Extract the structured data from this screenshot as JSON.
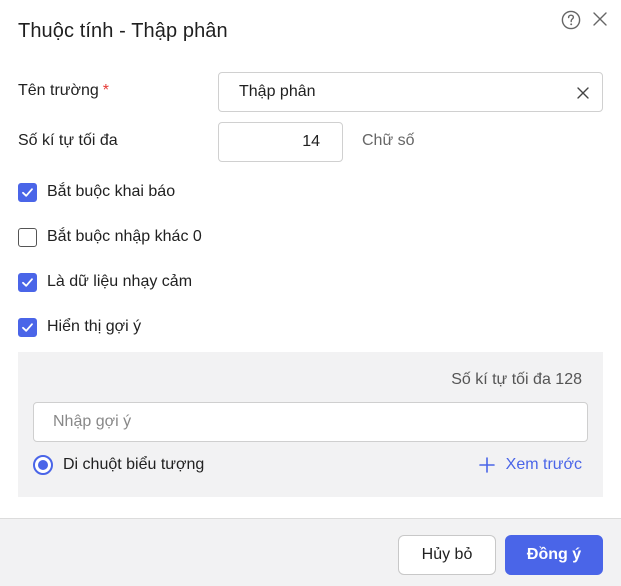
{
  "dialog": {
    "title": "Thuộc tính - Thập phân",
    "help_icon": "help-circle-icon",
    "close_icon": "close-icon"
  },
  "fields": {
    "name_label": "Tên trường",
    "name_required_mark": "*",
    "name_value": "Thập phân",
    "max_label": "Số kí tự tối đa",
    "max_value": "14",
    "max_unit": "Chữ số"
  },
  "checkboxes": [
    {
      "label": "Bắt buộc khai báo",
      "checked": true
    },
    {
      "label": "Bắt buộc nhập khác 0",
      "checked": false
    },
    {
      "label": "Là dữ liệu nhạy cảm",
      "checked": true
    },
    {
      "label": "Hiển thị gợi ý",
      "checked": true
    }
  ],
  "hint": {
    "counter": "Số kí tự tối đa 128",
    "placeholder": "Nhập gợi ý",
    "radio_label": "Di chuột biểu tượng",
    "radio_selected": true,
    "preview_label": "Xem trước"
  },
  "footer": {
    "cancel_label": "Hủy bỏ",
    "ok_label": "Đồng ý"
  },
  "colors": {
    "accent": "#4a65e8",
    "required": "#e53935",
    "panel_bg": "#f2f2f3"
  }
}
